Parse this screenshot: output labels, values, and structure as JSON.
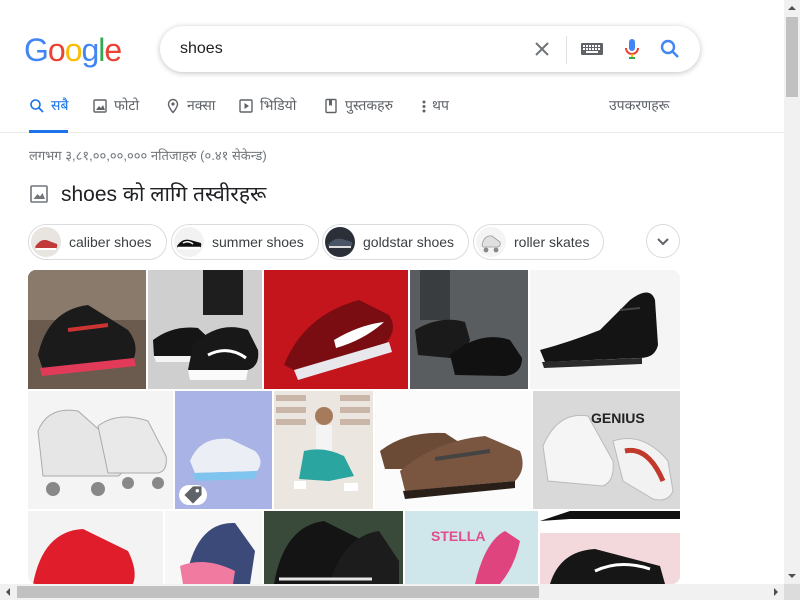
{
  "logo": {
    "letters": [
      "G",
      "o",
      "o",
      "g",
      "l",
      "e"
    ],
    "colors": [
      "#4285f4",
      "#ea4335",
      "#fbbc05",
      "#4285f4",
      "#34a853",
      "#ea4335"
    ]
  },
  "search": {
    "query": "shoes"
  },
  "tabs": [
    {
      "label": "सबै",
      "icon": "search-icon",
      "active": true
    },
    {
      "label": "फोटो",
      "icon": "image-icon",
      "active": false
    },
    {
      "label": "नक्सा",
      "icon": "map-pin-icon",
      "active": false
    },
    {
      "label": "भिडियो",
      "icon": "video-icon",
      "active": false
    },
    {
      "label": "पुस्तकहरु",
      "icon": "book-icon",
      "active": false
    },
    {
      "label": "थप",
      "icon": "more-vert-icon",
      "active": false
    }
  ],
  "tools_label": "उपकरणहरू",
  "result_stats": "लगभग ३,८१,००,००,००० नतिजाहरु (०.४१ सेकेन्ड)",
  "images_heading": "shoes को लागि तस्वीरहरू",
  "chips": [
    {
      "label": "caliber shoes"
    },
    {
      "label": "summer shoes"
    },
    {
      "label": "goldstar shoes"
    },
    {
      "label": "roller skates"
    }
  ],
  "image_texts": {
    "genius": "GENIUS",
    "stella": "STELLA"
  },
  "colors": {
    "accent": "#1a73e8",
    "muted": "#5f6368",
    "stats": "#70757a"
  }
}
